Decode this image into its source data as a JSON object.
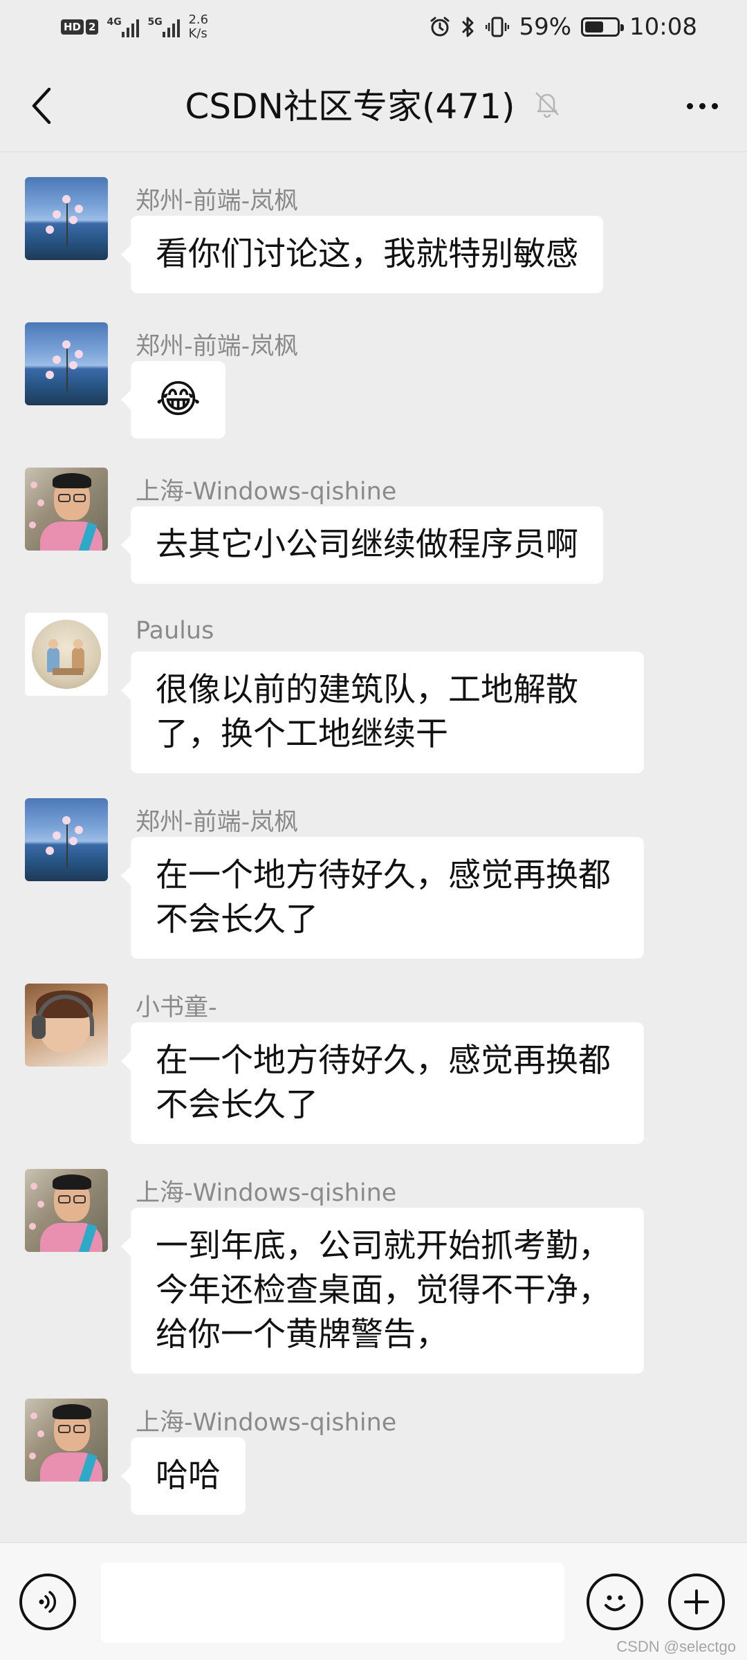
{
  "status_bar": {
    "hd_label": "HD",
    "sim_label": "2",
    "net1": "4G",
    "net2": "5G",
    "speed_value": "2.6",
    "speed_unit": "K/s",
    "battery": "59%",
    "battery_level": 0.59,
    "time": "10:08",
    "icons": [
      "alarm-icon",
      "bluetooth-icon",
      "vibrate-icon",
      "battery-icon"
    ]
  },
  "header": {
    "title": "CSDN社区专家(471)",
    "muted": true
  },
  "messages": [
    {
      "sender": "郑州-前端-岚枫",
      "text": "看你们讨论这，我就特别敏感",
      "avatar": "lake-flowers"
    },
    {
      "sender": "郑州-前端-岚枫",
      "text": "😂",
      "avatar": "lake-flowers"
    },
    {
      "sender": "上海-Windows-qishine",
      "text": "去其它小公司继续做程序员啊",
      "avatar": "man-glasses"
    },
    {
      "sender": "Paulus",
      "text": "很像以前的建筑队，工地解散了，换个工地继续干",
      "avatar": "couple-table"
    },
    {
      "sender": "郑州-前端-岚枫",
      "text": "在一个地方待好久，感觉再换都不会长久了",
      "avatar": "lake-flowers"
    },
    {
      "sender": "小书童-",
      "text": "在一个地方待好久，感觉再换都不会长久了",
      "avatar": "child-headphones"
    },
    {
      "sender": "上海-Windows-qishine",
      "text": "一到年底，公司就开始抓考勤，今年还检查桌面，觉得不干净，给你一个黄牌警告，",
      "avatar": "man-glasses"
    },
    {
      "sender": "上海-Windows-qishine",
      "text": "哈哈",
      "avatar": "man-glasses"
    }
  ],
  "input_bar": {
    "value": "",
    "placeholder": ""
  },
  "watermark": "CSDN @selectgo"
}
